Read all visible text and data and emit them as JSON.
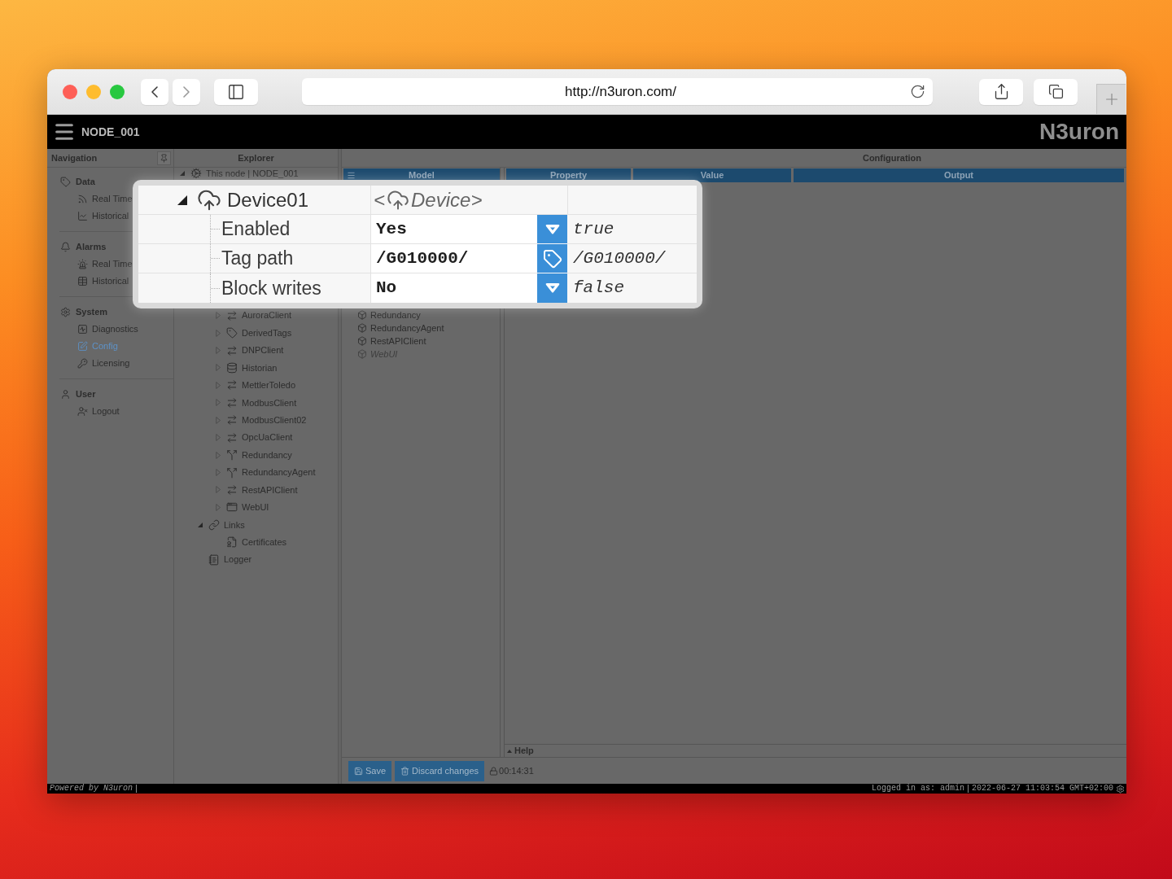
{
  "browser": {
    "url": "http://n3uron.com/"
  },
  "header": {
    "node": "NODE_001",
    "logo": "N3uron"
  },
  "navigation": {
    "title": "Navigation",
    "sections": [
      {
        "kind": "data",
        "label": "Data",
        "items": [
          {
            "kind": "live",
            "label": "Real Time",
            "selected": false
          },
          {
            "kind": "history",
            "label": "Historical",
            "selected": false
          }
        ]
      },
      {
        "kind": "alarms",
        "label": "Alarms",
        "items": [
          {
            "kind": "live",
            "label": "Real Time",
            "selected": false
          },
          {
            "kind": "history",
            "label": "Historical",
            "selected": false
          }
        ]
      },
      {
        "kind": "system",
        "label": "System",
        "items": [
          {
            "kind": "diagnostics",
            "label": "Diagnostics",
            "selected": false
          },
          {
            "kind": "config",
            "label": "Config",
            "selected": true
          },
          {
            "kind": "licensing",
            "label": "Licensing",
            "selected": false
          }
        ]
      },
      {
        "kind": "user",
        "label": "User",
        "items": [
          {
            "kind": "logout",
            "label": "Logout",
            "selected": false
          }
        ]
      }
    ]
  },
  "explorer": {
    "title": "Explorer",
    "tree": [
      {
        "kind": "node",
        "label": "This node | NODE_001",
        "expanded": true,
        "children": [
          {
            "children": [
              {
                "kind": "client",
                "label": "AuroraClient",
                "expanded": false
              },
              {
                "kind": "tags",
                "label": "DerivedTags",
                "expanded": false
              },
              {
                "kind": "client",
                "label": "DNPClient",
                "expanded": false
              },
              {
                "kind": "historian",
                "label": "Historian",
                "expanded": false
              },
              {
                "kind": "client",
                "label": "MettlerToledo",
                "expanded": false
              },
              {
                "kind": "client",
                "label": "ModbusClient",
                "expanded": false
              },
              {
                "kind": "client",
                "label": "ModbusClient02",
                "expanded": false
              },
              {
                "kind": "client",
                "label": "OpcUaClient",
                "expanded": false
              },
              {
                "kind": "redundancy",
                "label": "Redundancy",
                "expanded": false
              },
              {
                "kind": "redundancy",
                "label": "RedundancyAgent",
                "expanded": false
              },
              {
                "kind": "client",
                "label": "RestAPIClient",
                "expanded": false
              },
              {
                "kind": "webui",
                "label": "WebUI",
                "expanded": false
              }
            ]
          },
          {
            "kind": "links",
            "label": "Links",
            "expanded": true,
            "children": [
              {
                "kind": "certificates",
                "label": "Certificates"
              }
            ]
          },
          {
            "kind": "logger",
            "label": "Logger"
          }
        ]
      }
    ]
  },
  "configuration": {
    "title": "Configuration",
    "model": {
      "title": "Model",
      "items": [
        {
          "label": "Redundancy",
          "disabled": false
        },
        {
          "label": "RedundancyAgent",
          "disabled": false
        },
        {
          "label": "RestAPIClient",
          "disabled": false
        },
        {
          "label": "WebUI",
          "disabled": true
        }
      ]
    },
    "columns": [
      "Property",
      "Value",
      "Output"
    ],
    "help": "Help",
    "actions": [
      {
        "kind": "save",
        "label": "Save"
      },
      {
        "kind": "discard",
        "label": "Discard changes"
      }
    ],
    "session_time": "00:14:31"
  },
  "footer": {
    "powered_by": "Powered by N3uron",
    "user": "Logged in as: admin",
    "datetime": "2022-06-27 11:03:54 GMT+02:00"
  },
  "callout": {
    "label": "Device01",
    "expanded": true,
    "model": [
      "<",
      "Device>"
    ],
    "properties": [
      {
        "kind": "select",
        "name": "Enabled",
        "value": "Yes",
        "output": "true"
      },
      {
        "kind": "tag",
        "name": "Tag path",
        "value": "/G010000/",
        "output": "/G010000/"
      },
      {
        "kind": "select",
        "name": "Block writes",
        "value": "No",
        "output": "false"
      }
    ]
  }
}
